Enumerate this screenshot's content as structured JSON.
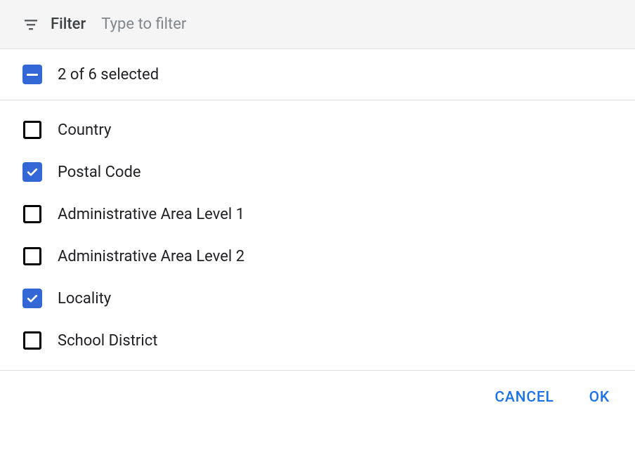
{
  "filter": {
    "label": "Filter",
    "placeholder": "Type to filter",
    "value": ""
  },
  "selection": {
    "summary": "2 of 6 selected",
    "state": "indeterminate"
  },
  "options": [
    {
      "label": "Country",
      "checked": false
    },
    {
      "label": "Postal Code",
      "checked": true
    },
    {
      "label": "Administrative Area Level 1",
      "checked": false
    },
    {
      "label": "Administrative Area Level 2",
      "checked": false
    },
    {
      "label": "Locality",
      "checked": true
    },
    {
      "label": "School District",
      "checked": false
    }
  ],
  "actions": {
    "cancel": "CANCEL",
    "ok": "OK"
  }
}
